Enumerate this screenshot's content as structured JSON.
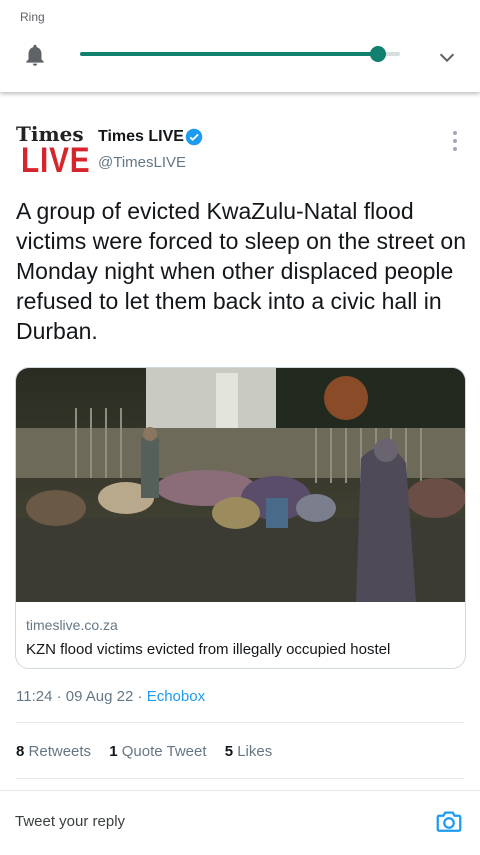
{
  "volume_panel": {
    "label": "Ring",
    "level": 0.93,
    "accent_color": "#12806f",
    "icons": [
      "bell-icon",
      "chevron-down-icon"
    ]
  },
  "tweet": {
    "avatar": {
      "top": "Times",
      "bottom": "LIVE"
    },
    "display_name": "Times LIVE",
    "handle": "@TimesLIVE",
    "text": "A group of evicted KwaZulu-Natal flood victims were forced to sleep on the street on Monday night when other displaced people refused to let them back into a civic hall in Durban.",
    "card": {
      "domain": "timeslive.co.za",
      "title": "KZN flood victims evicted from illegally occupied hostel"
    },
    "time": "11:24",
    "date": "09 Aug 22",
    "source": "Echobox",
    "stats": {
      "retweets_count": "8",
      "retweets_label": "Retweets",
      "quotes_count": "1",
      "quotes_label": "Quote Tweet",
      "likes_count": "5",
      "likes_label": "Likes"
    },
    "reply_placeholder": "Tweet your reply"
  }
}
